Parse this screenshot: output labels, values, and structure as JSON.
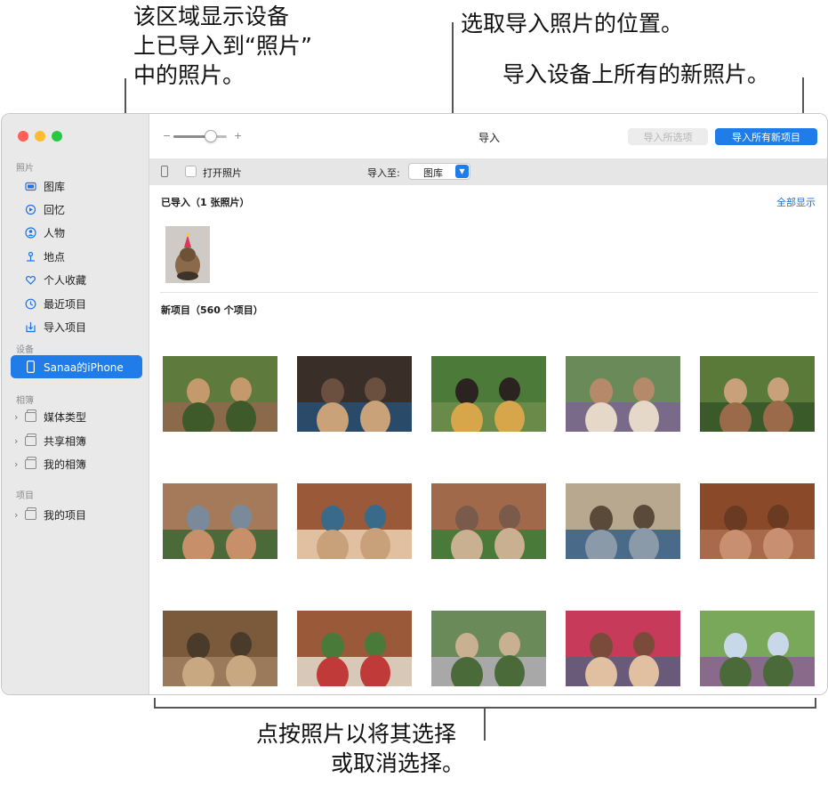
{
  "callouts": {
    "left": [
      "该区域显示设备",
      "上已导入到“照片”",
      "中的照片。"
    ],
    "middle": "选取导入照片的位置。",
    "right": "导入设备上所有的新照片。",
    "bottom": [
      "点按照片以将其选择",
      "或取消选择。"
    ]
  },
  "sidebar": {
    "sections": [
      {
        "header": "照片",
        "items": [
          {
            "label": "图库",
            "icon": "library-icon"
          },
          {
            "label": "回忆",
            "icon": "memories-icon"
          },
          {
            "label": "人物",
            "icon": "people-icon"
          },
          {
            "label": "地点",
            "icon": "places-icon"
          },
          {
            "label": "个人收藏",
            "icon": "heart-icon"
          },
          {
            "label": "最近项目",
            "icon": "clock-icon"
          },
          {
            "label": "导入项目",
            "icon": "import-icon"
          }
        ]
      },
      {
        "header": "设备",
        "items": [
          {
            "label": "Sanaa的iPhone",
            "icon": "iphone-icon",
            "selected": true
          }
        ]
      },
      {
        "header": "相簿",
        "items": [
          {
            "label": "媒体类型",
            "icon": "folder-icon"
          },
          {
            "label": "共享相簿",
            "icon": "folder-icon"
          },
          {
            "label": "我的相簿",
            "icon": "folder-icon"
          }
        ]
      },
      {
        "header": "项目",
        "items": [
          {
            "label": "我的项目",
            "icon": "folder-icon"
          }
        ]
      }
    ]
  },
  "toolbar": {
    "zoom_minus": "−",
    "zoom_plus": "+",
    "zoom_level": 0.7,
    "title": "导入",
    "import_selected_label": "导入所选项",
    "import_all_label": "导入所有新项目"
  },
  "subbar": {
    "open_photos_label": "打开照片",
    "open_photos_checked": false,
    "import_to_label": "导入至:",
    "import_to_value": "图库"
  },
  "imported": {
    "header": "已导入（1 张照片）",
    "show_all": "全部显示"
  },
  "new_items": {
    "header": "新项目（560 个项目）"
  },
  "colors": {
    "accent": "#1f7ce8",
    "sidebar_bg": "#e9e9e9",
    "subbar_bg": "#e6e6e6"
  }
}
